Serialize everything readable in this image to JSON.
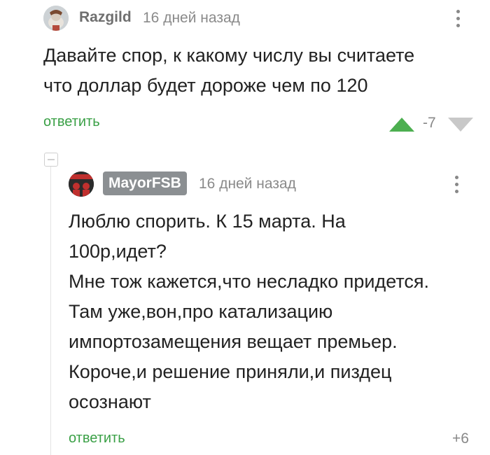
{
  "comments": [
    {
      "username": "Razgild",
      "time": "16 дней назад",
      "text": "Давайте спор, к какому числу вы считаете\nчто доллар будет дороже чем по 120",
      "reply_label": "ответить",
      "rating": "-7"
    },
    {
      "username": "MayorFSB",
      "time": "16 дней назад",
      "text": "Люблю спорить. К 15 марта. На\n100р,идет?\nМне тож кажется,что несладко придется.\nТам уже,вон,про катализацию\nимпортозамещения вещает премьер.\nКороче,и решение приняли,и пиздец\nосознают",
      "reply_label": "ответить",
      "rating": "+6"
    }
  ],
  "colors": {
    "reply_green": "#3aa046",
    "vote_up_green": "#4caf50",
    "vote_down_gray": "#c8c8c8",
    "badge_gray": "#8b8f92"
  },
  "icons": {
    "vote_up": "triangle-up-icon",
    "vote_down": "triangle-down-icon",
    "menu": "more-vertical-icon",
    "collapse": "minus-square-icon"
  }
}
